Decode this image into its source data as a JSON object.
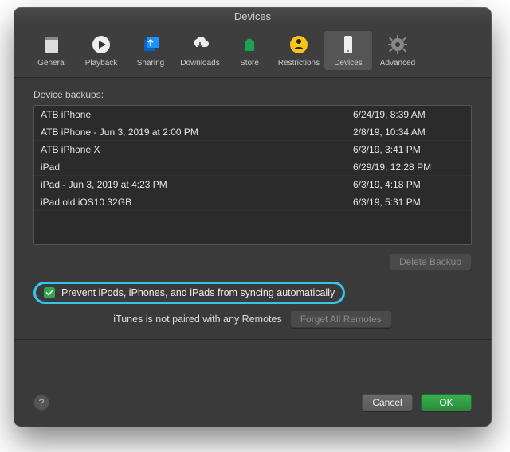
{
  "window": {
    "title": "Devices"
  },
  "tabs": [
    {
      "label": "General"
    },
    {
      "label": "Playback"
    },
    {
      "label": "Sharing"
    },
    {
      "label": "Downloads"
    },
    {
      "label": "Store"
    },
    {
      "label": "Restrictions"
    },
    {
      "label": "Devices",
      "selected": true
    },
    {
      "label": "Advanced"
    }
  ],
  "backups": {
    "label": "Device backups:",
    "rows": [
      {
        "name": "ATB iPhone",
        "time": "6/24/19, 8:39 AM"
      },
      {
        "name": "ATB iPhone - Jun 3, 2019 at 2:00 PM",
        "time": "2/8/19, 10:34 AM"
      },
      {
        "name": "ATB iPhone X",
        "time": "6/3/19, 3:41 PM"
      },
      {
        "name": "iPad",
        "time": "6/29/19, 12:28 PM"
      },
      {
        "name": "iPad - Jun 3, 2019 at 4:23 PM",
        "time": "6/3/19, 4:18 PM"
      },
      {
        "name": "iPad old iOS10 32GB",
        "time": "6/3/19, 5:31 PM"
      }
    ]
  },
  "buttons": {
    "delete_backup": "Delete Backup",
    "forget_remotes": "Forget All Remotes",
    "cancel": "Cancel",
    "ok": "OK"
  },
  "prevent": {
    "label": "Prevent iPods, iPhones, and iPads from syncing automatically",
    "checked": true
  },
  "remotes": {
    "text": "iTunes is not paired with any Remotes"
  },
  "help": {
    "label": "?"
  },
  "colors": {
    "accent_green": "#2fa84f",
    "highlight": "#37c5e6"
  }
}
